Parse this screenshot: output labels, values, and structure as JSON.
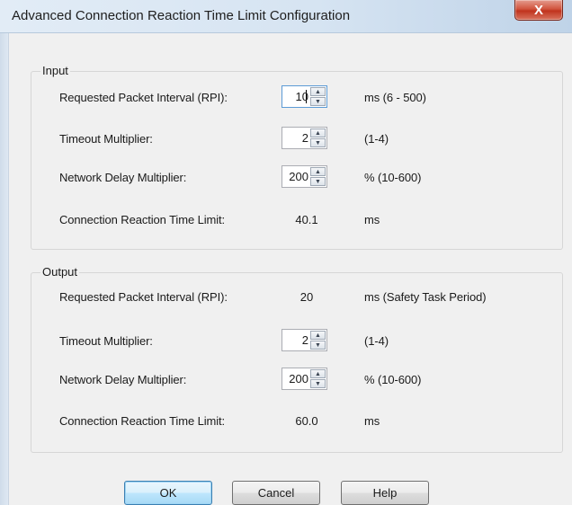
{
  "window": {
    "title": "Advanced Connection Reaction Time Limit Configuration",
    "close_glyph": "X"
  },
  "input": {
    "group_label": "Input",
    "rpi_label": "Requested Packet Interval (RPI):",
    "rpi_value": "10",
    "rpi_unit": "ms (6 - 500)",
    "timeout_label": "Timeout Multiplier:",
    "timeout_value": "2",
    "timeout_range": "(1-4)",
    "delay_label": "Network Delay Multiplier:",
    "delay_value": "200",
    "delay_range": "% (10-600)",
    "crtl_label": "Connection Reaction Time Limit:",
    "crtl_value": "40.1",
    "crtl_unit": "ms"
  },
  "output": {
    "group_label": "Output",
    "rpi_label": "Requested Packet Interval (RPI):",
    "rpi_value": "20",
    "rpi_unit": "ms (Safety Task Period)",
    "timeout_label": "Timeout Multiplier:",
    "timeout_value": "2",
    "timeout_range": "(1-4)",
    "delay_label": "Network Delay Multiplier:",
    "delay_value": "200",
    "delay_range": "% (10-600)",
    "crtl_label": "Connection Reaction Time Limit:",
    "crtl_value": "60.0",
    "crtl_unit": "ms"
  },
  "buttons": {
    "ok": "OK",
    "cancel": "Cancel",
    "help": "Help"
  },
  "icons": {
    "spin_up": "▲",
    "spin_down": "▼"
  },
  "colors": {
    "close_button": "#c7432c",
    "title_bar": "#d6e4f2",
    "default_button_border": "#3c7fb1"
  }
}
